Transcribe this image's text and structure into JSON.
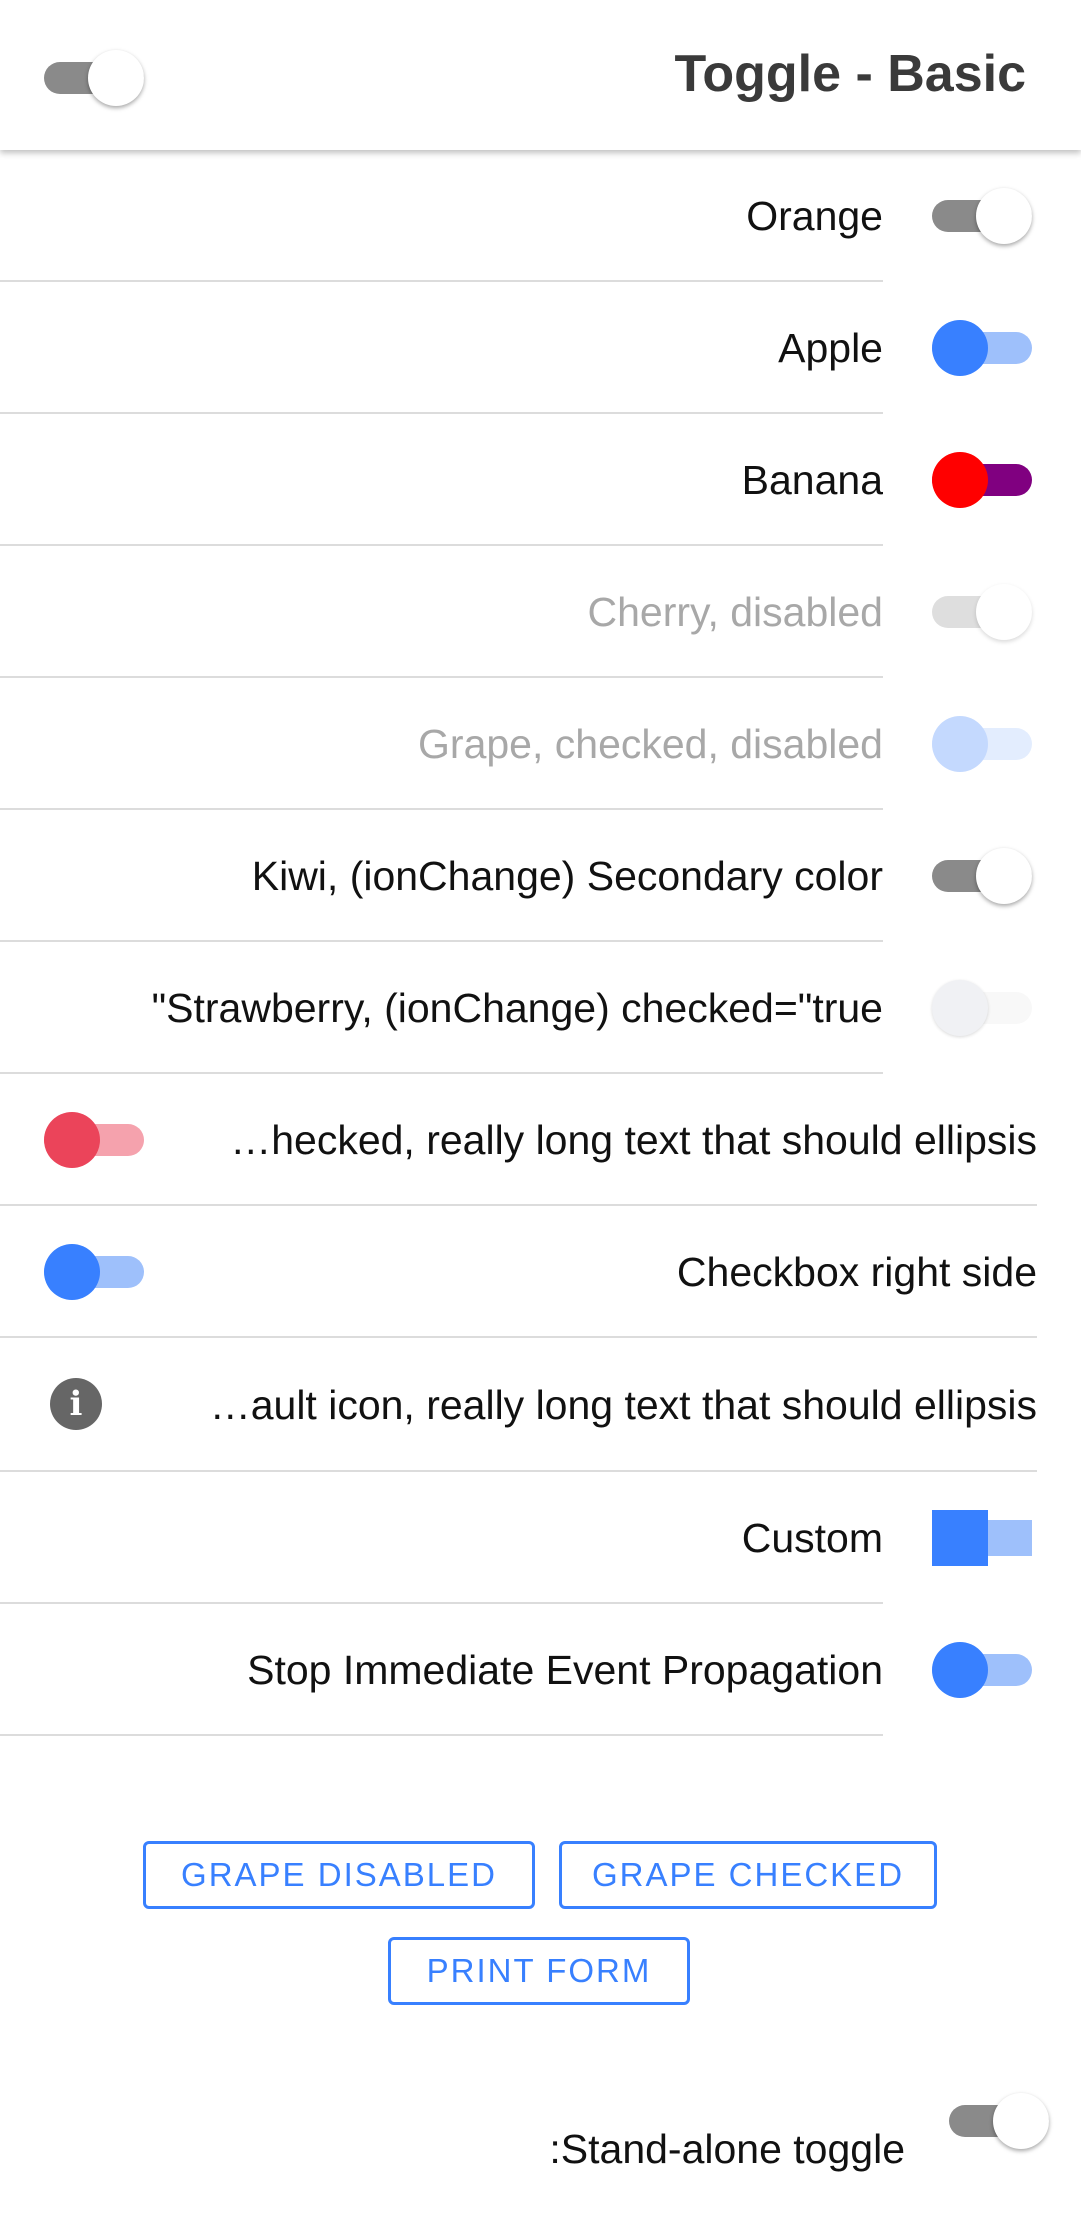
{
  "header": {
    "title": "Toggle - Basic"
  },
  "items": [
    {
      "label": "Orange"
    },
    {
      "label": "Apple"
    },
    {
      "label": "Banana"
    },
    {
      "label": "Cherry, disabled"
    },
    {
      "label": "Grape, checked, disabled"
    },
    {
      "label": "Kiwi, (ionChange) Secondary color"
    },
    {
      "label": "\"Strawberry, (ionChange) checked=\"true"
    },
    {
      "label": "…hecked, really long text that should ellipsis"
    },
    {
      "label": "Checkbox right side"
    },
    {
      "label": "…ault icon, really long text that should ellipsis"
    },
    {
      "label": "Custom"
    },
    {
      "label": "Stop Immediate Event Propagation"
    }
  ],
  "buttons": {
    "grape_disabled": "GRAPE DISABLED",
    "grape_checked": "GRAPE CHECKED",
    "print_form": "PRINT FORM"
  },
  "standalone": {
    "label": ":Stand-alone toggle"
  },
  "colors": {
    "primary": "#3880ff",
    "danger": "#eb445a",
    "banana_knob": "#ff0000",
    "banana_track": "#800080",
    "off_track": "#888888"
  }
}
